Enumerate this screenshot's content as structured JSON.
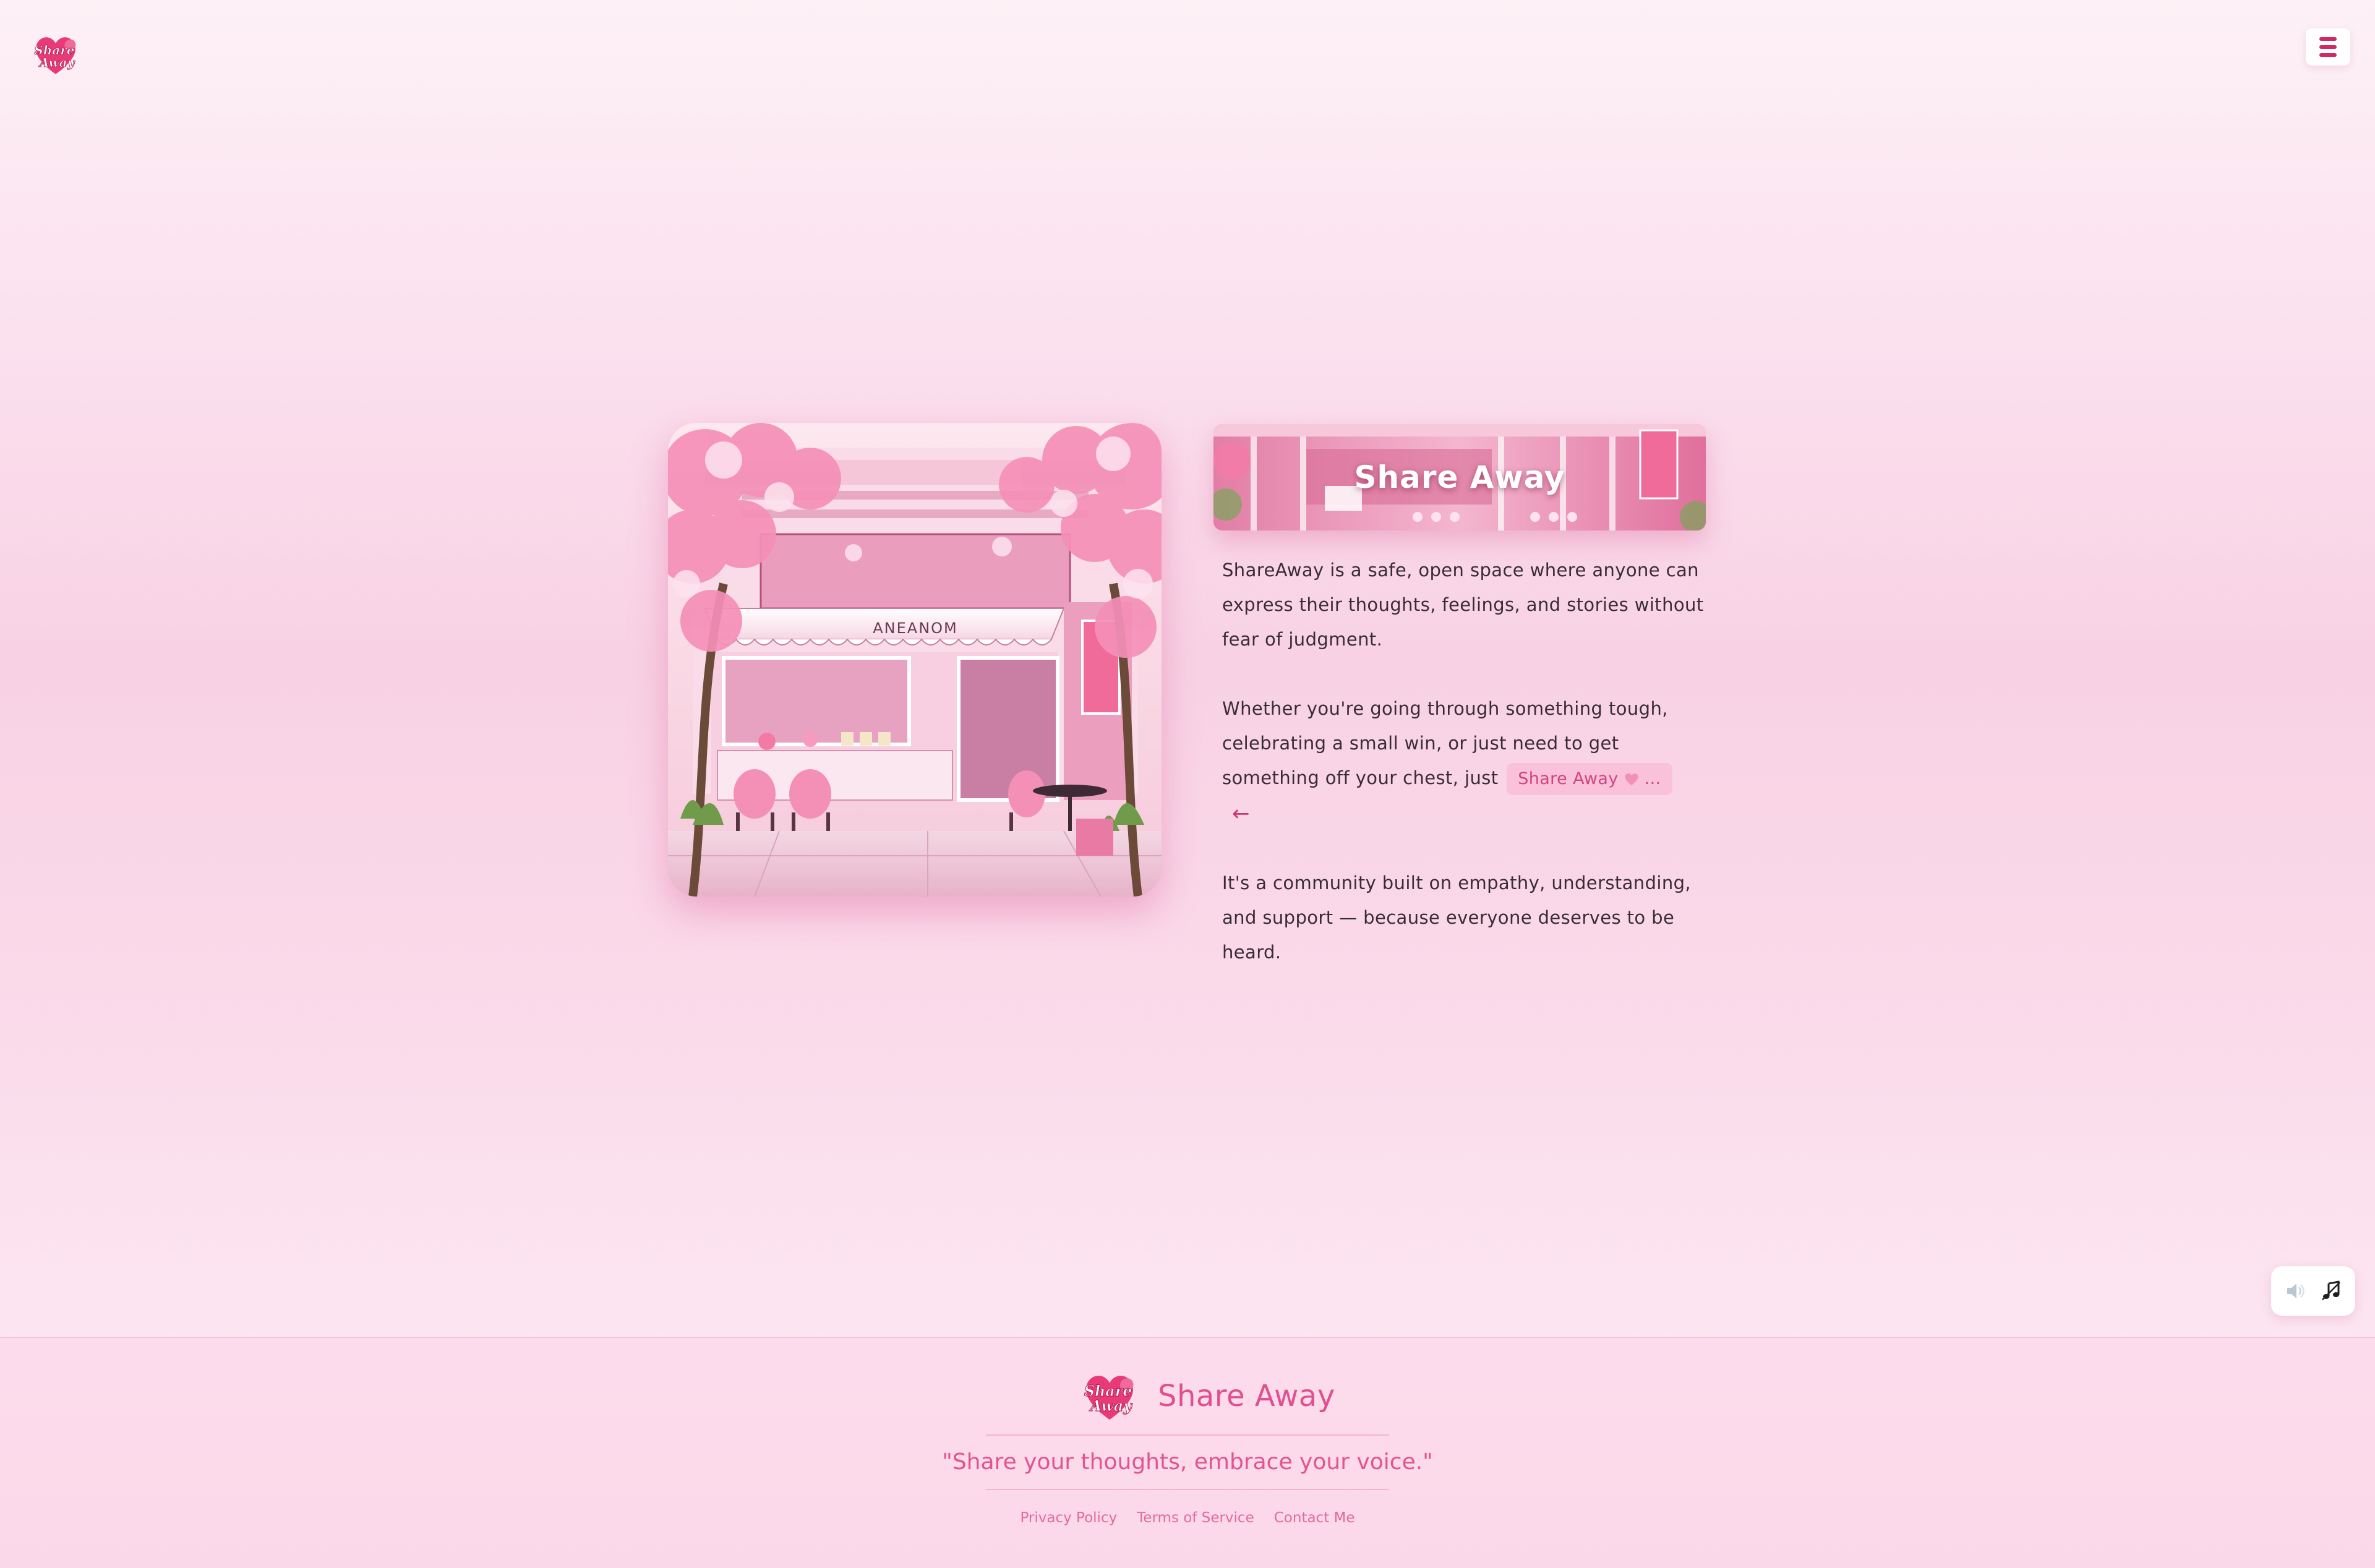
{
  "header": {
    "logo_icon": "share-away-heart-logo",
    "menu_icon": "hamburger-menu-icon"
  },
  "hero": {
    "image_alt": "Illustrated pink storefront with cherry blossom trees",
    "storefront_sign": "ANEANOM",
    "banner_title": "Share Away"
  },
  "content": {
    "paragraph_1": "ShareAway is a safe, open space where anyone can express their thoughts, feelings, and stories without fear of judgment.",
    "paragraph_2_text": "Whether you're going through something tough, celebrating a small win, or just need to get something off your chest, just",
    "share_button": {
      "label": "Share Away",
      "icon": "heart-icon",
      "ellipsis": "..."
    },
    "arrow": "←",
    "paragraph_3": "It's a community built on empathy, understanding, and support — because everyone deserves to be heard."
  },
  "audio": {
    "sound_icon": "speaker-icon",
    "music_icon": "music-note-icon"
  },
  "footer": {
    "brand": "Share Away",
    "quote": "\"Share your thoughts, embrace your voice.\"",
    "links": [
      "Privacy Policy",
      "Terms of Service",
      "Contact Me"
    ]
  },
  "colors": {
    "accent": "#e04f8f",
    "accent_dark": "#d3275f",
    "background": "#fbe0ee",
    "button_bg": "#f9c2da"
  }
}
